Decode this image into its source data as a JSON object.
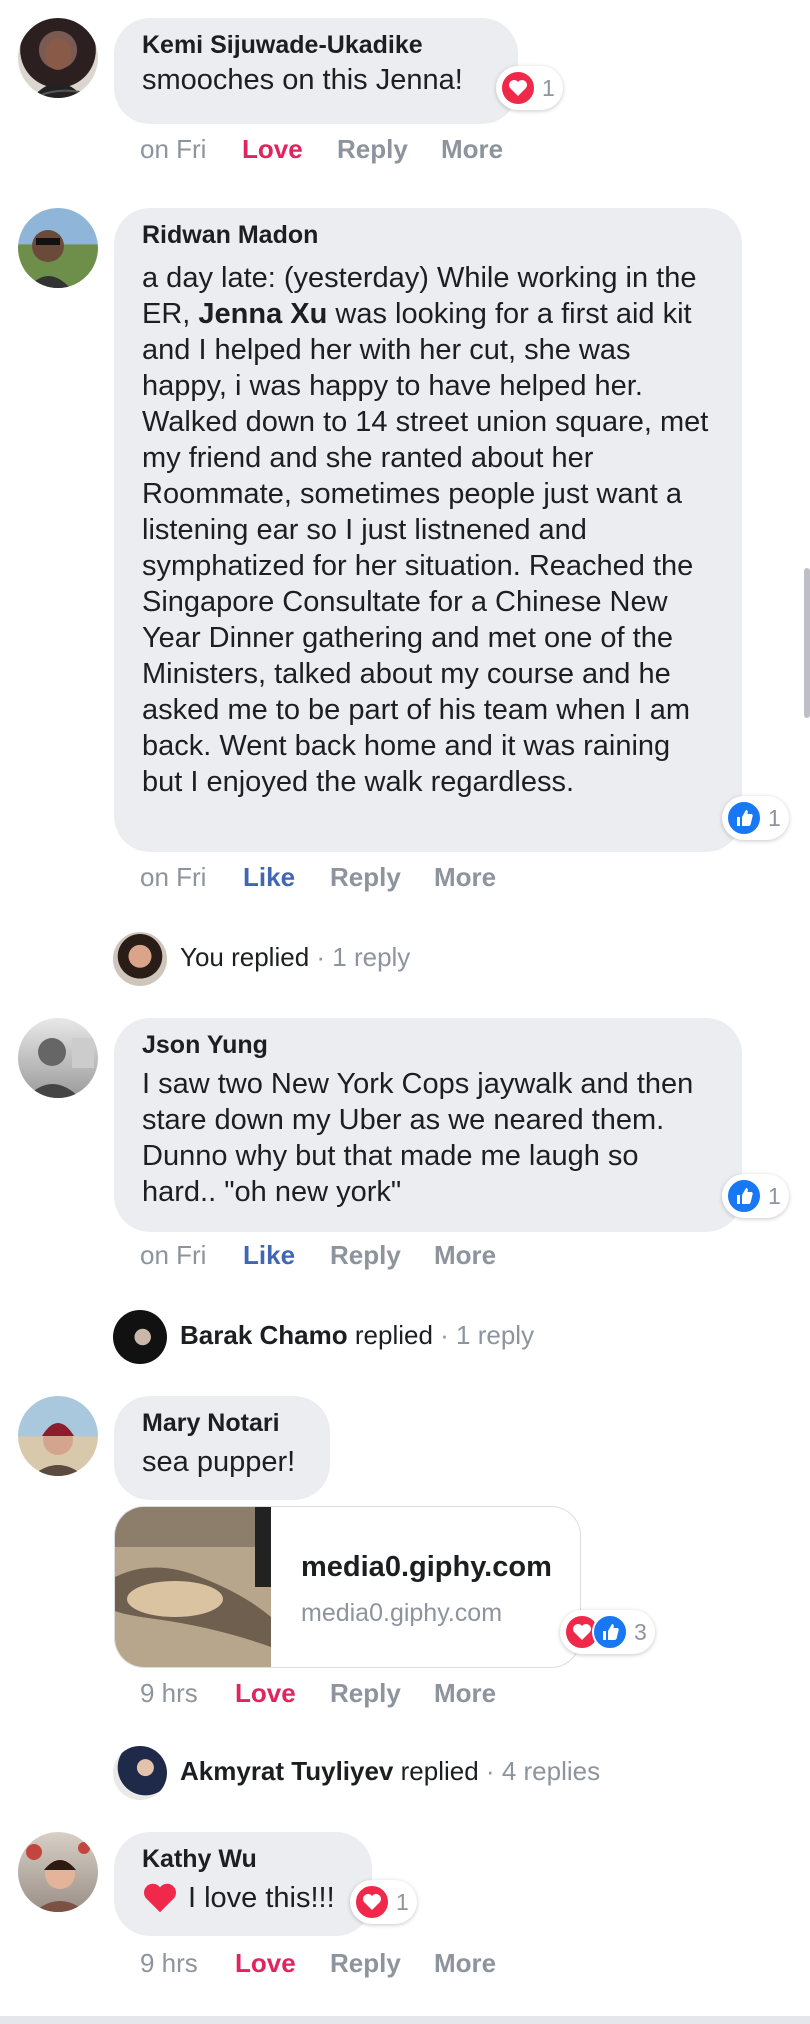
{
  "comments": [
    {
      "author": "Kemi Sijuwade-Ukadike",
      "text": "smooches on this Jenna!",
      "time": "on Fri",
      "react_label": "Love",
      "reply_label": "Reply",
      "more_label": "More",
      "reaction_count": "1"
    },
    {
      "author": "Ridwan Madon",
      "text_before": "a day late: (yesterday) While working in the ER, ",
      "mention": "Jenna Xu",
      "text_after": " was looking for a first aid kit and I helped her with her cut, she was happy, i was happy to have helped her. Walked down to 14 street union square, met my friend and she ranted about her Roommate, sometimes people just want a listening ear so I just listnened and symphatized for her situation. Reached the Singapore Consultate for a Chinese New Year Dinner gathering and met one of the Ministers, talked about my course and he asked me to be part of his team when I am back. Went back home and it was raining but I enjoyed the walk regardless.",
      "time": "on Fri",
      "react_label": "Like",
      "reply_label": "Reply",
      "more_label": "More",
      "reaction_count": "1",
      "replies": {
        "who": "You replied",
        "count": "1 reply"
      }
    },
    {
      "author": "Json Yung",
      "text": "I saw two New York Cops jaywalk and then stare down my Uber as we neared them. Dunno why but that made me laugh so hard.. \"oh new york\"",
      "time": "on Fri",
      "react_label": "Like",
      "reply_label": "Reply",
      "more_label": "More",
      "reaction_count": "1",
      "replies": {
        "name": "Barak Chamo",
        "verb": "replied",
        "count": "1 reply"
      }
    },
    {
      "author": "Mary Notari",
      "text": "sea pupper!",
      "link_title": "media0.giphy.com",
      "link_domain": "media0.giphy.com",
      "time": "9 hrs",
      "react_label": "Love",
      "reply_label": "Reply",
      "more_label": "More",
      "reaction_count": "3",
      "replies": {
        "name": "Akmyrat Tuyliyev",
        "verb": "replied",
        "count": "4 replies"
      }
    },
    {
      "author": "Kathy Wu",
      "text": "I love this!!!",
      "time": "9 hrs",
      "react_label": "Love",
      "reply_label": "Reply",
      "more_label": "More",
      "reaction_count": "1"
    }
  ],
  "separator": " · ",
  "colors": {
    "love": "#e0245e",
    "like": "#4267b2",
    "bubble": "#ebedf0",
    "muted": "#8d949e"
  },
  "icons": [
    "heart-icon",
    "thumbs-up-icon"
  ]
}
